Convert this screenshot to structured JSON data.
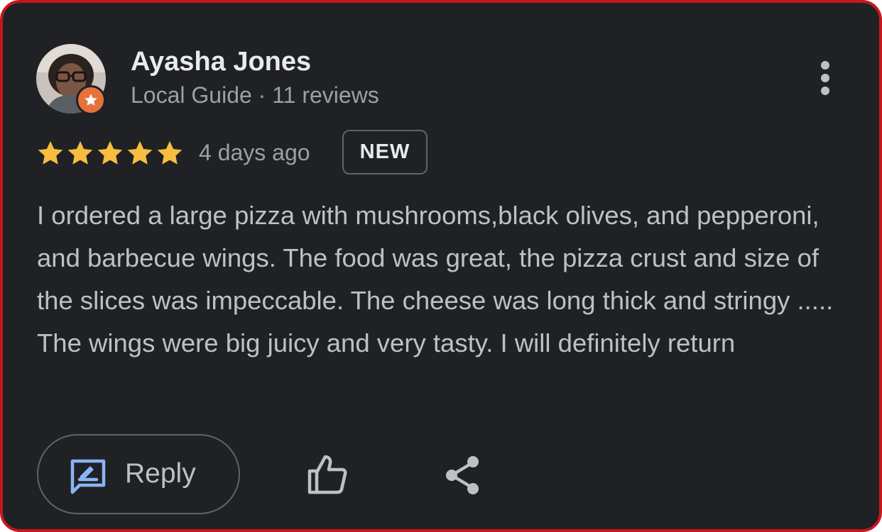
{
  "reviewer": {
    "name": "Ayasha Jones",
    "meta": "Local Guide · 11 reviews",
    "avatar_icon": "user-avatar-icon",
    "badge_icon": "local-guide-star-icon",
    "badge_color": "#e8713a"
  },
  "menu": {
    "icon": "more-vert-icon"
  },
  "rating": {
    "stars": 5,
    "max": 5,
    "star_color": "#f6bd41",
    "date": "4 days ago",
    "badge": "NEW"
  },
  "review": {
    "text": "I ordered a large pizza with mushrooms,black olives, and pepperoni, and barbecue wings. The food was great, the pizza crust and size of the slices was impeccable. The cheese was long thick and stringy ..... The wings were big juicy and very tasty. I will definitely return"
  },
  "actions": {
    "reply_label": "Reply",
    "reply_icon": "reply-icon",
    "reply_icon_color": "#8ab4f8",
    "like_icon": "thumbs-up-icon",
    "share_icon": "share-icon"
  },
  "colors": {
    "background": "#202124",
    "border": "#c8161d",
    "primary_text": "#e8eaed",
    "secondary_text": "#9aa0a6"
  }
}
